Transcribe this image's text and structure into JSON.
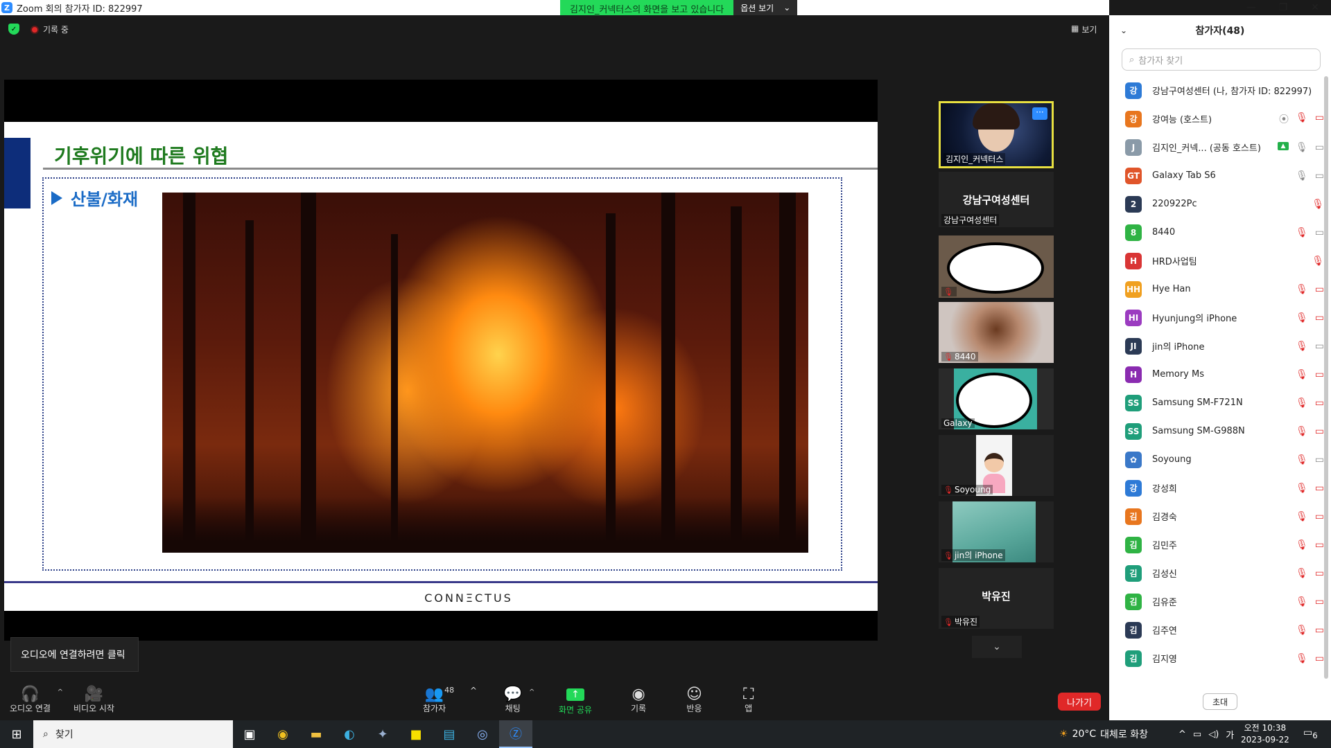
{
  "window": {
    "title": "Zoom 회의 참가자 ID: 822997",
    "logo_letter": "Z",
    "controls": [
      "—",
      "❐",
      "✕"
    ]
  },
  "share_banner": {
    "text": "김지인_커넥터스의 화면을 보고 있습니다",
    "options_label": "옵션 보기",
    "options_caret": "⌄"
  },
  "meeting_header": {
    "security_glyph": "✓",
    "recording_label": "기록 중",
    "view_label": "보기",
    "view_icon": "view-grid-icon"
  },
  "slide": {
    "title": "기후위기에 따른 위협",
    "bullet": "산불/화재",
    "footer_logo": "CONNΞCTUS",
    "colors": {
      "title": "#1e7a1e",
      "bullet": "#1a6bc6",
      "bluebar": "#0d2d7a"
    }
  },
  "audio_tooltip": "오디오에 연결하려면 클릭",
  "gallery": {
    "tiles": [
      {
        "label": "김지인_커넥터스",
        "more": "···"
      },
      {
        "title": "강남구여성센터",
        "label": "강남구여성센터"
      },
      {
        "label": ""
      },
      {
        "label": "8440"
      },
      {
        "label": "Galaxy"
      },
      {
        "label": "Soyoung"
      },
      {
        "label": "jin의 iPhone"
      },
      {
        "title": "박유진",
        "label": "박유진"
      }
    ],
    "scroll_glyph": "⌄"
  },
  "toolbar": {
    "audio": "오디오 연결",
    "video": "비디오 시작",
    "participants": "참가자",
    "participant_count": "48",
    "chat": "채팅",
    "share": "화면 공유",
    "record": "기록",
    "reactions": "반응",
    "apps": "앱",
    "leave": "나가기",
    "caret": "^"
  },
  "panel": {
    "title": "참가자(48)",
    "collapse_glyph": "⌄",
    "search_placeholder": "참가자 찾기",
    "invite": "초대",
    "participants": [
      {
        "initial": "강",
        "color": "#2d7ad6",
        "name": "강남구여성센터 (나, 참가자 ID: 822997)",
        "mic": "",
        "video": ""
      },
      {
        "initial": "강",
        "color": "#e8761e",
        "name": "강여능 (호스트)",
        "mic": "off",
        "video": "off",
        "extra": "⦿"
      },
      {
        "initial": "J",
        "color": "#8a9aa8",
        "name": "김지인_커넥... (공동 호스트)",
        "mic": "on",
        "video": "on",
        "share": true
      },
      {
        "initial": "GT",
        "color": "#e0552a",
        "name": "Galaxy Tab S6",
        "mic": "on",
        "video": "on"
      },
      {
        "initial": "2",
        "color": "#2b3a55",
        "name": "220922Pc",
        "mic": "off",
        "video": ""
      },
      {
        "initial": "8",
        "color": "#2fb344",
        "name": "8440",
        "mic": "off",
        "video": "on"
      },
      {
        "initial": "H",
        "color": "#d93535",
        "name": "HRD사업팀",
        "mic": "off",
        "video": ""
      },
      {
        "initial": "HH",
        "color": "#f0a020",
        "name": "Hye Han",
        "mic": "off",
        "video": "off"
      },
      {
        "initial": "HI",
        "color": "#9b3bc0",
        "name": "Hyunjung의 iPhone",
        "mic": "off",
        "video": "off"
      },
      {
        "initial": "JI",
        "color": "#2b3a55",
        "name": "jin의 iPhone",
        "mic": "off",
        "video": "on"
      },
      {
        "initial": "H",
        "color": "#8a2bb0",
        "name": "Memory Ms",
        "mic": "off",
        "video": "off"
      },
      {
        "initial": "SS",
        "color": "#1f9e7a",
        "name": "Samsung SM-F721N",
        "mic": "off",
        "video": "off"
      },
      {
        "initial": "SS",
        "color": "#1f9e7a",
        "name": "Samsung SM-G988N",
        "mic": "off",
        "video": "off"
      },
      {
        "initial": "✿",
        "color": "#3a78c8",
        "name": "Soyoung",
        "mic": "off",
        "video": "on"
      },
      {
        "initial": "강",
        "color": "#2d7ad6",
        "name": "강성희",
        "mic": "off",
        "video": "off"
      },
      {
        "initial": "김",
        "color": "#e8761e",
        "name": "김경숙",
        "mic": "off",
        "video": "off"
      },
      {
        "initial": "김",
        "color": "#2fb344",
        "name": "김민주",
        "mic": "off",
        "video": "off"
      },
      {
        "initial": "김",
        "color": "#1f9e7a",
        "name": "김성신",
        "mic": "off",
        "video": "off"
      },
      {
        "initial": "김",
        "color": "#2fb344",
        "name": "김유준",
        "mic": "off",
        "video": "off"
      },
      {
        "initial": "김",
        "color": "#2b3a55",
        "name": "김주연",
        "mic": "off",
        "video": "off"
      },
      {
        "initial": "김",
        "color": "#1f9e7a",
        "name": "김지영",
        "mic": "off",
        "video": "off"
      }
    ]
  },
  "taskbar": {
    "search_label": "찾기",
    "weather_temp": "20°C",
    "weather_text": "대체로 화창",
    "ime": "가",
    "time": "오전 10:38",
    "date": "2023-09-22",
    "notifications": "6"
  }
}
